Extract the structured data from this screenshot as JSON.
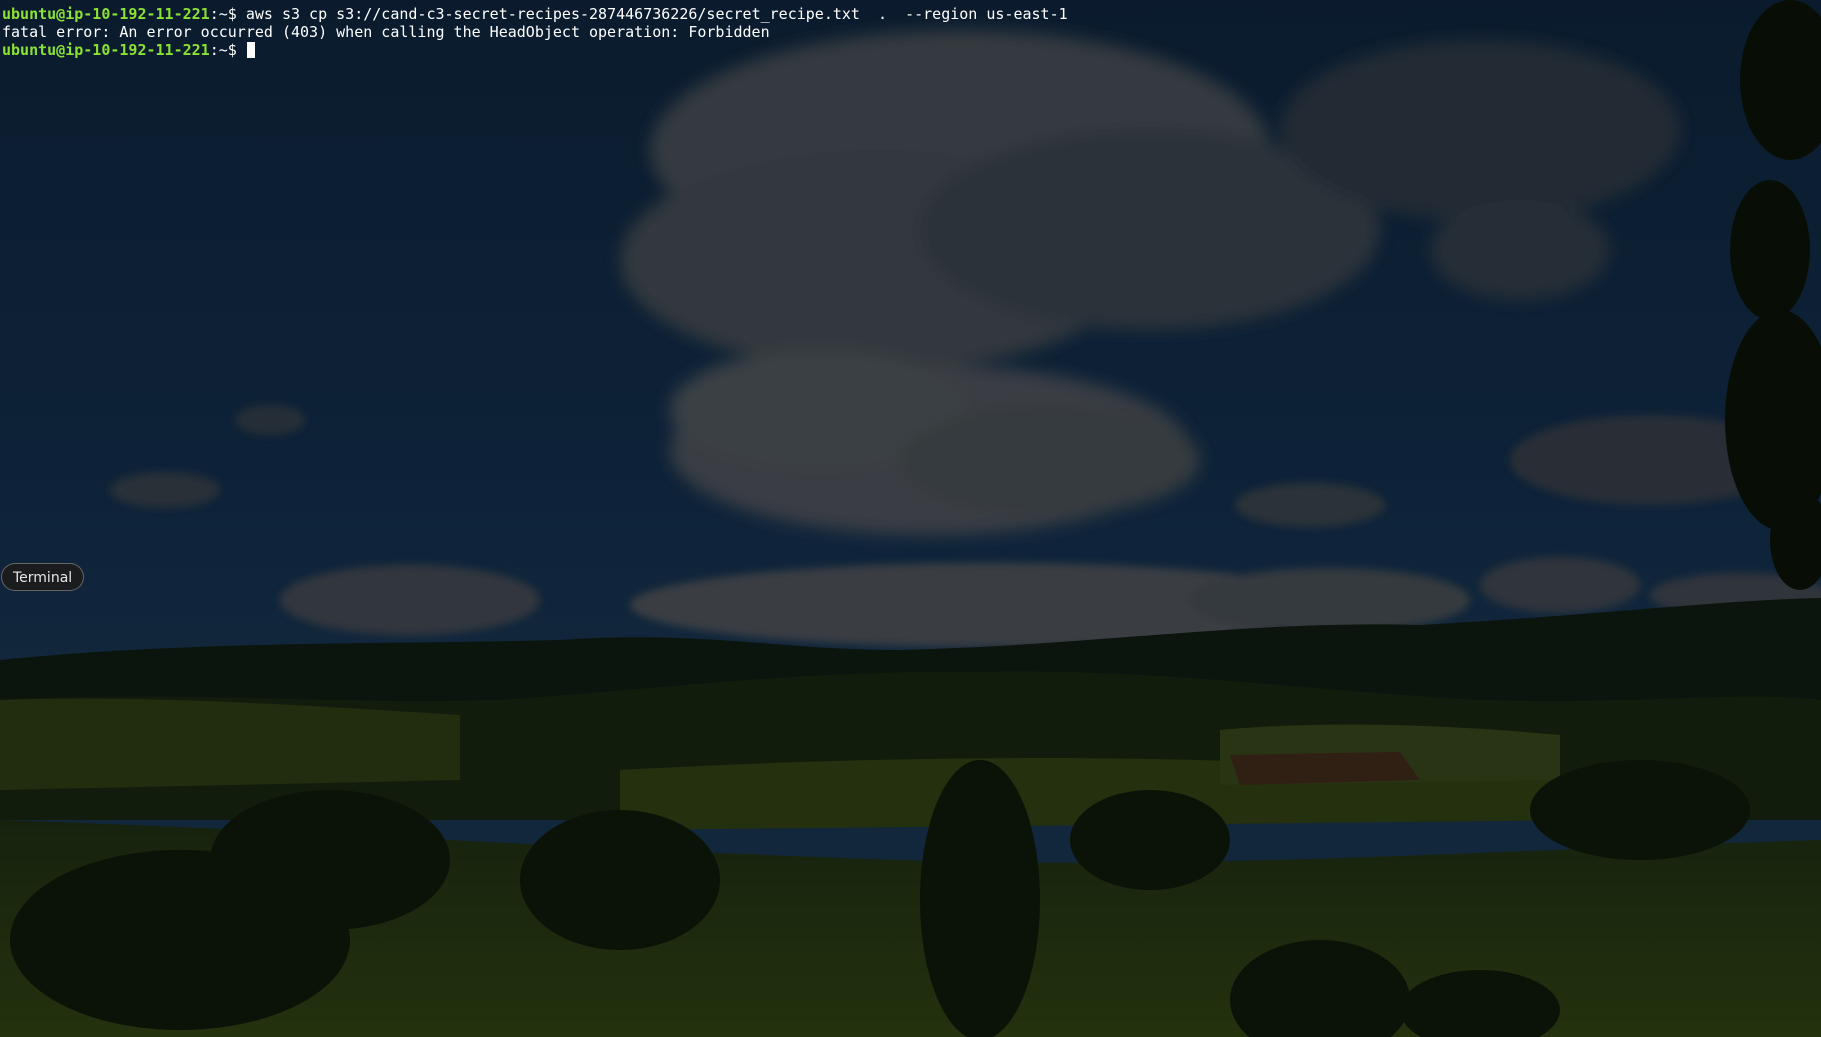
{
  "terminal": {
    "lines": [
      {
        "prompt": {
          "userhost": "ubuntu@ip-10-192-11-221",
          "sep": ":",
          "path": "~",
          "dollar": "$ "
        },
        "command": "aws s3 cp s3://cand-c3-secret-recipes-287446736226/secret_recipe.txt  .  --region us-east-1"
      },
      {
        "output": "fatal error: An error occurred (403) when calling the HeadObject operation: Forbidden"
      },
      {
        "prompt": {
          "userhost": "ubuntu@ip-10-192-11-221",
          "sep": ":",
          "path": "~",
          "dollar": "$ "
        },
        "command": ""
      }
    ]
  },
  "tooltip": {
    "label": "Terminal"
  },
  "colors": {
    "prompt_userhost": "#8ae234",
    "terminal_text": "#ffffff",
    "tooltip_bg": "#1c1c1c",
    "sky_dark": "#0b1d33",
    "field_green": "#2a3c10"
  }
}
